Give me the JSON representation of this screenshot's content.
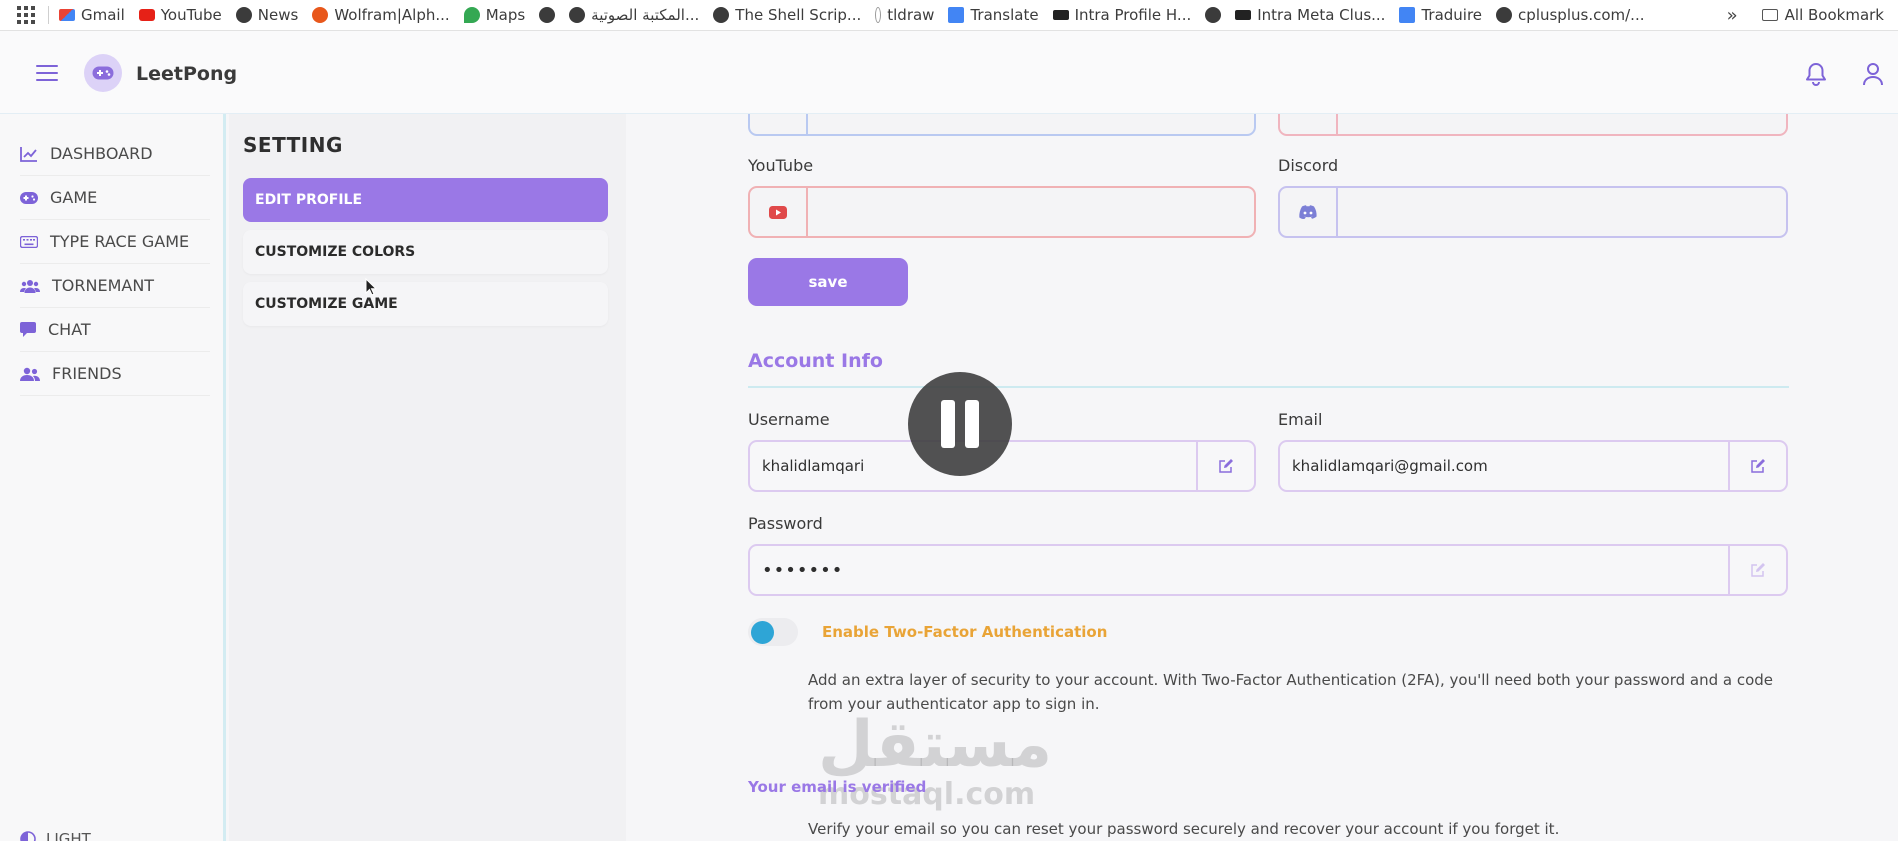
{
  "bookmarks": {
    "items": [
      {
        "label": "Gmail",
        "icon": "gmail-icon"
      },
      {
        "label": "YouTube",
        "icon": "youtube-icon"
      },
      {
        "label": "News",
        "icon": "globe-icon"
      },
      {
        "label": "Wolfram|Alph...",
        "icon": "wolfram-icon"
      },
      {
        "label": "Maps",
        "icon": "maps-icon"
      },
      {
        "label": "",
        "icon": "globe-icon"
      },
      {
        "label": "المكتبة الصوتية...",
        "icon": "globe-icon"
      },
      {
        "label": "The Shell Scrip...",
        "icon": "globe-icon"
      },
      {
        "label": "tldraw",
        "icon": "tldraw-icon"
      },
      {
        "label": "Translate",
        "icon": "translate-icon"
      },
      {
        "label": "Intra Profile H...",
        "icon": "intra-icon"
      },
      {
        "label": "",
        "icon": "globe-icon"
      },
      {
        "label": "Intra Meta Clus...",
        "icon": "intra-icon"
      },
      {
        "label": "Traduire",
        "icon": "translate-icon"
      },
      {
        "label": "cplusplus.com/...",
        "icon": "globe-icon"
      }
    ],
    "more": "»",
    "all_bookmarks": "All Bookmark"
  },
  "header": {
    "app_name": "LeetPong"
  },
  "sidebar": {
    "items": [
      {
        "label": "DASHBOARD",
        "icon": "chart-line-icon"
      },
      {
        "label": "GAME",
        "icon": "gamepad-icon"
      },
      {
        "label": "TYPE RACE GAME",
        "icon": "keyboard-icon"
      },
      {
        "label": "TORNEMANT",
        "icon": "users-icon"
      },
      {
        "label": "CHAT",
        "icon": "chat-icon"
      },
      {
        "label": "FRIENDS",
        "icon": "friends-icon"
      }
    ],
    "theme_label": "LIGHT"
  },
  "settings": {
    "title": "SETTING",
    "buttons": [
      {
        "label": "EDIT PROFILE",
        "active": true
      },
      {
        "label": "CUSTOMIZE COLORS",
        "active": false
      },
      {
        "label": "CUSTOMIZE GAME",
        "active": false
      }
    ]
  },
  "social": {
    "youtube_label": "YouTube",
    "youtube_value": "",
    "discord_label": "Discord",
    "discord_value": "",
    "save_label": "save"
  },
  "account": {
    "title": "Account Info",
    "username_label": "Username",
    "username_value": "khalidlamqari",
    "email_label": "Email",
    "email_value": "khalidlamqari@gmail.com",
    "password_label": "Password",
    "password_value": "•••••••",
    "twofa_label": "Enable Two-Factor Authentication",
    "twofa_enabled": true,
    "twofa_desc": "Add an extra layer of security to your account. With Two-Factor Authentication (2FA), you'll need both your password and a code from your authenticator app to sign in.",
    "verified_label": "Your email is verified",
    "verify_desc": "Verify your email so you can reset your password securely and recover your account if you forget it."
  },
  "watermark": {
    "arabic": "مستقل",
    "latin": "mostaql.com"
  },
  "colors": {
    "accent": "#9a78e6",
    "youtube": "#e0494a",
    "discord": "#7c7fd6",
    "warning": "#e9a437",
    "toggle_on": "#2ea5d6"
  }
}
